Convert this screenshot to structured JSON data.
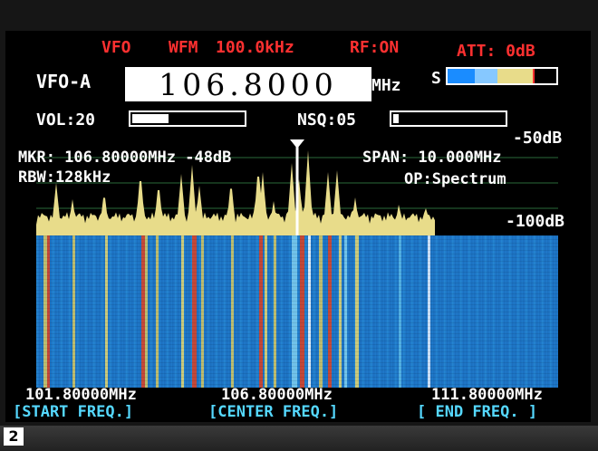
{
  "status": {
    "vfo": "VFO",
    "mode": "WFM",
    "step": "100.0kHz",
    "rf": "RF:ON",
    "att": "ATT: 0dB"
  },
  "vfo_row": {
    "label": "VFO-A",
    "frequency": "106.8000",
    "unit": "MHz",
    "s_label": "S",
    "s_meter_segments": [
      {
        "color": "#1a8cff",
        "fraction": 0.25
      },
      {
        "color": "#86c8ff",
        "fraction": 0.22
      },
      {
        "color": "#e8dc8a",
        "fraction": 0.33
      },
      {
        "color": "#000000",
        "fraction": 0.2
      }
    ]
  },
  "controls": {
    "vol_label": "VOL:20",
    "vol_level": 0.33,
    "nsq_label": "NSQ:05",
    "nsq_level": 0.05
  },
  "spectrum": {
    "ref_top": "-50dB",
    "ref_bottom": "-100dB",
    "marker": "MKR: 106.80000MHz -48dB",
    "span": "SPAN: 10.000MHz",
    "rbw": "RBW:128kHz",
    "op": "OP:Spectrum"
  },
  "axis": {
    "start": "101.80000MHz",
    "center": "106.80000MHz",
    "end": "111.80000MHz"
  },
  "softkeys": {
    "start": "[START FREQ.]",
    "center": "[CENTER FREQ.]",
    "end": "[ END FREQ. ]"
  },
  "figure_number": "2",
  "colors": {
    "trace": "#e8dc8a",
    "waterfall_base": "#1f78c8",
    "marker": "#ffffff"
  }
}
